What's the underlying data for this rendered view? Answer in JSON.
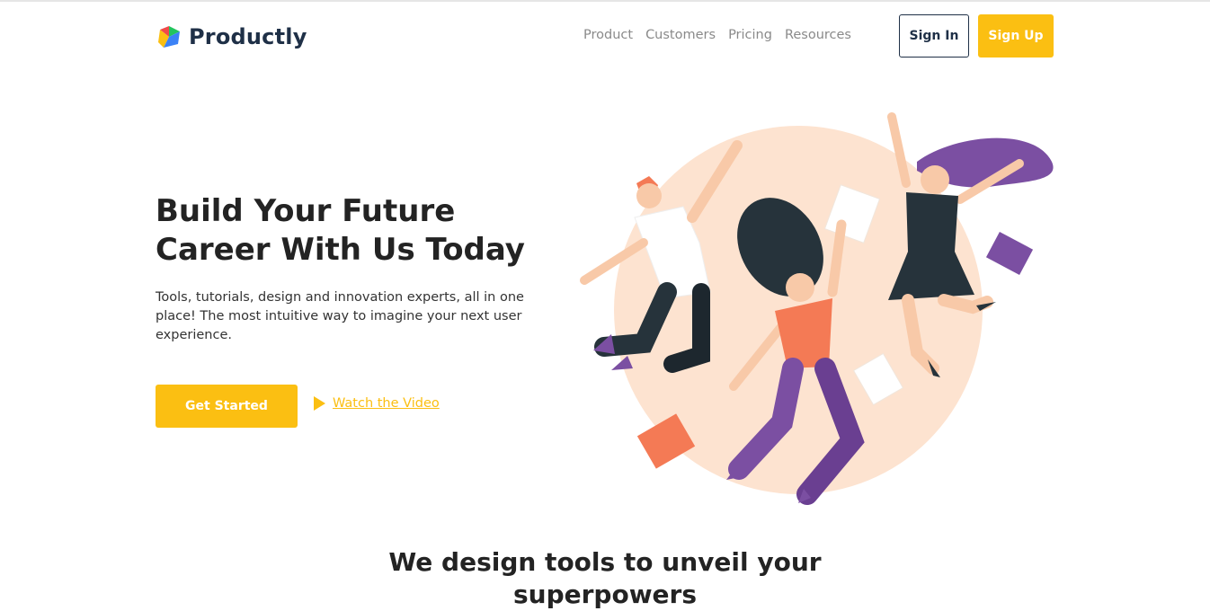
{
  "brand": {
    "name": "Productly",
    "logo_icon": "productly-logo-icon",
    "colors": {
      "blue": "#3b82f6",
      "red": "#f04a4a",
      "yellow": "#fbbf12",
      "green": "#22c55e"
    }
  },
  "nav": {
    "items": [
      {
        "label": "Product"
      },
      {
        "label": "Customers"
      },
      {
        "label": "Pricing"
      },
      {
        "label": "Resources"
      }
    ]
  },
  "auth": {
    "sign_in": "Sign In",
    "sign_up": "Sign Up"
  },
  "hero": {
    "title_line1": "Build Your Future",
    "title_line2": "Career With Us Today",
    "description": "Tools, tutorials, design and innovation experts, all in one place! The most intuitive way to imagine your next user experience.",
    "cta_primary": "Get Started",
    "cta_secondary": "Watch the Video",
    "cta_secondary_icon": "play-icon",
    "illustration": "jumping-people-illustration"
  },
  "section": {
    "title_line1": "We design tools to unveil your",
    "title_line2": "superpowers"
  },
  "colors": {
    "accent": "#fbbf12",
    "heading": "#232323",
    "brand_dark": "#1f3047",
    "nav_text": "#8a8a8a",
    "blob": "#fde3d0",
    "purple": "#7b4fa2",
    "coral": "#f47a55",
    "dark": "#26333b"
  }
}
